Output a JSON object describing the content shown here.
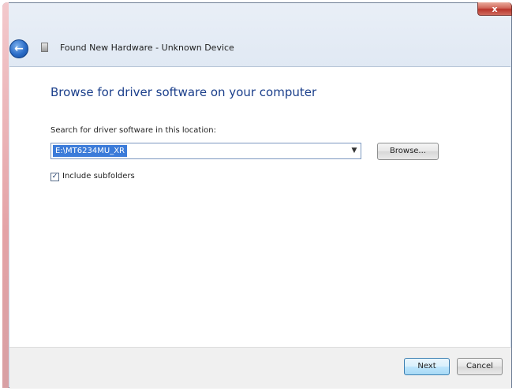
{
  "window": {
    "title": "Found New Hardware - Unknown Device",
    "close_label": "x"
  },
  "main": {
    "heading": "Browse for driver software on your computer",
    "search_label": "Search for driver software in this location:",
    "path_value": "E:\\MT6234MU_XR",
    "dropdown_arrow": "▼",
    "browse_label": "Browse...",
    "include_subfolders_label": "Include subfolders",
    "include_subfolders_checked": "✓"
  },
  "footer": {
    "next_label": "Next",
    "cancel_label": "Cancel"
  },
  "icons": {
    "back": "back-arrow-icon",
    "hardware": "hardware-device-icon"
  },
  "colors": {
    "heading": "#1b3f8b",
    "selection": "#3b7bd9",
    "close": "#c8473b"
  }
}
